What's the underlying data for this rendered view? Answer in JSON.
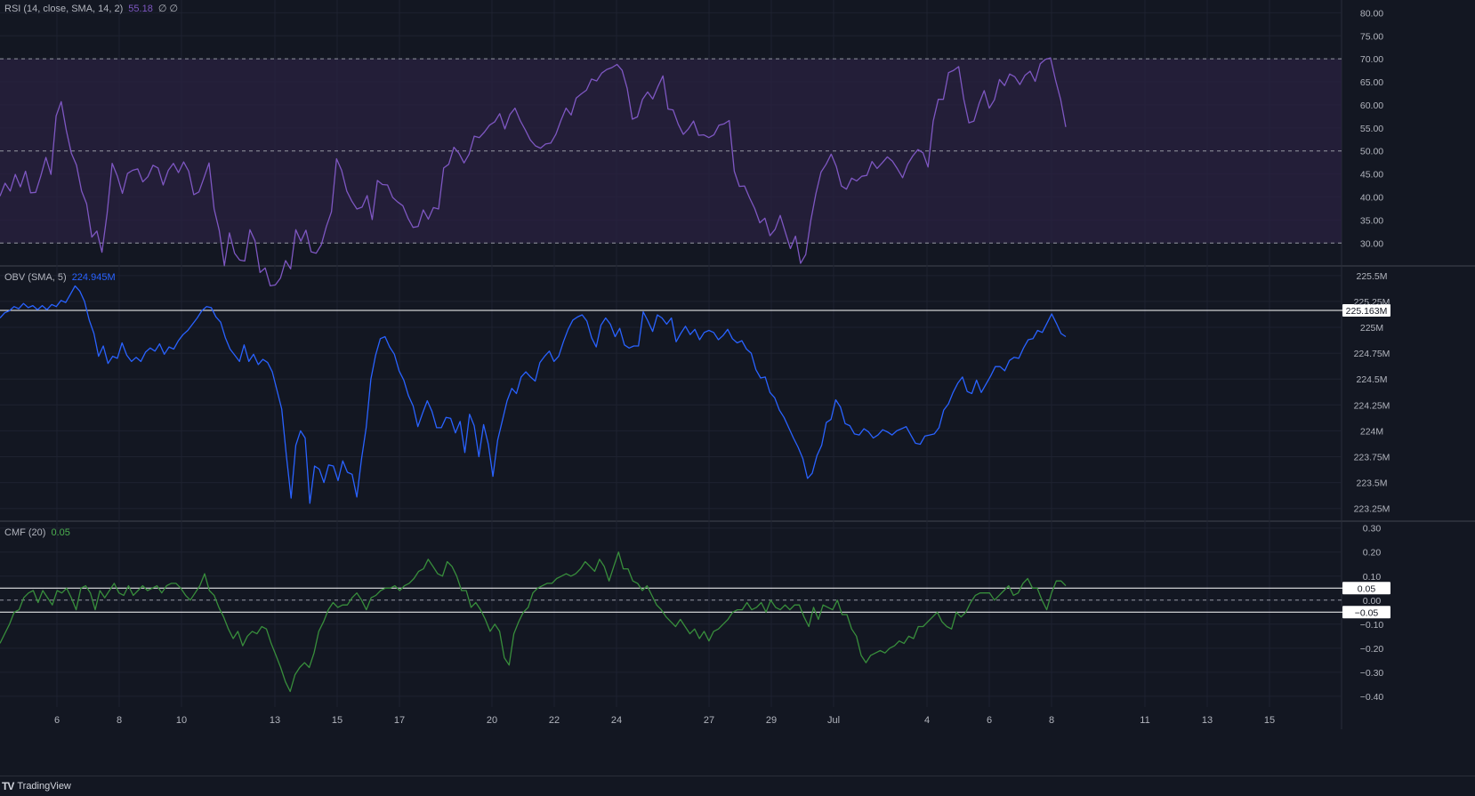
{
  "brand": {
    "name": "TradingView",
    "logo": "TV"
  },
  "colors": {
    "background": "#131722",
    "grid": "#1e2230",
    "separator": "#2a2e39",
    "rsi": "#7e57c2",
    "rsi_band": "#2a2140",
    "obv": "#2962ff",
    "cmf": "#388e3c",
    "level_line": "#ffffff",
    "text": "#b2b5be"
  },
  "x_axis": {
    "labels": [
      "6",
      "8",
      "10",
      "13",
      "15",
      "17",
      "20",
      "22",
      "24",
      "27",
      "29",
      "Jul",
      "4",
      "6",
      "8",
      "11",
      "13",
      "15"
    ]
  },
  "chart_data": [
    {
      "type": "line",
      "title": "RSI (14, close, SMA, 14, 2)",
      "legend_value": "55.18",
      "legend_extra": "∅ ∅",
      "ylim": [
        26,
        82
      ],
      "y_ticks": [
        "80.00",
        "75.00",
        "70.00",
        "65.00",
        "60.00",
        "55.00",
        "50.00",
        "45.00",
        "40.00",
        "35.00",
        "30.00"
      ],
      "levels": [
        70,
        50,
        30
      ],
      "band": [
        30,
        70
      ],
      "series": [
        {
          "values": [
            40.2,
            43,
            41.3,
            44.9,
            42.2,
            45.6,
            40.9,
            41,
            44.6,
            48.6,
            44.9,
            57.6,
            60.7,
            54.5,
            49.5,
            46.9,
            41.3,
            38.5,
            31.3,
            32.6,
            28,
            36.4,
            47.3,
            44.6,
            40.8,
            45.1,
            45.8,
            46.1,
            43.3,
            44.4,
            46.9,
            46.3,
            42.6,
            45.8,
            47.3,
            45.3,
            47.6,
            45.6,
            40.5,
            41.1,
            44.2,
            47.4,
            37.4,
            32.7,
            25.1,
            32.2,
            27.8,
            26.3,
            26.1,
            32.9,
            30.5,
            23.6,
            24.6,
            20.7,
            20.9,
            22.4,
            26.2,
            24.4,
            32.9,
            30.4,
            32.8,
            28.1,
            27.8,
            29.6,
            33.6,
            36.8,
            48.3,
            45.8,
            41.3,
            39.1,
            37.4,
            37.8,
            40.3,
            35.1,
            43.6,
            42.7,
            42.6,
            39.9,
            38.9,
            38.1,
            35.4,
            33.4,
            33.6,
            37.2,
            35.2,
            37.7,
            37.4,
            46.3,
            47.1,
            50.8,
            49.5,
            47.4,
            49.3,
            53.2,
            52.9,
            54.1,
            55.6,
            56.3,
            58.1,
            54.8,
            57.9,
            59.3,
            56.6,
            54.6,
            52.4,
            51.1,
            50.6,
            51.5,
            51.7,
            53.6,
            56.6,
            59.3,
            57.8,
            61.5,
            62.4,
            63.2,
            65.6,
            65.2,
            66.9,
            67.7,
            68.1,
            68.8,
            67.5,
            63.6,
            56.9,
            57.4,
            61.2,
            62.8,
            61.3,
            63.9,
            66.3,
            59.1,
            58.9,
            55.8,
            53.6,
            54.8,
            56.5,
            53.4,
            53.5,
            52.9,
            53.5,
            55.6,
            55.9,
            56.6,
            45.6,
            42.3,
            42.4,
            39.8,
            37.5,
            34.4,
            35.4,
            31.6,
            33,
            36,
            32.4,
            28.8,
            31.5,
            25.6,
            27.5,
            34.9,
            40.7,
            45.4,
            47.1,
            49.3,
            46.6,
            42.4,
            41.7,
            44.1,
            43.5,
            44.5,
            44.7,
            47.7,
            46.2,
            47.4,
            48.7,
            47.8,
            46.1,
            44.2,
            47.1,
            48.9,
            50.3,
            49.6,
            46.5,
            56.5,
            61.2,
            61.2,
            67,
            67.5,
            68.3,
            61.2,
            56.1,
            56.5,
            60.3,
            63.1,
            59.3,
            61.1,
            65.5,
            64.2,
            66.7,
            66.1,
            64.4,
            66.4,
            67.3,
            65.1,
            68.9,
            69.9,
            70.2,
            65.4,
            61.1,
            55.2
          ]
        }
      ]
    },
    {
      "type": "line",
      "title": "OBV (SMA, 5)",
      "legend_value": "224.945M",
      "ylim": [
        223.17,
        225.55
      ],
      "y_ticks": [
        "225.5M",
        "225.25M",
        "225M",
        "224.75M",
        "224.5M",
        "224.25M",
        "224M",
        "223.75M",
        "223.5M",
        "223.25M"
      ],
      "y_tick_values": [
        225.5,
        225.25,
        225,
        224.75,
        224.5,
        224.25,
        224,
        223.75,
        223.5,
        223.25
      ],
      "levels": [
        225.163
      ],
      "level_labels": [
        "225.163M"
      ],
      "series": [
        {
          "values": [
            225.09,
            225.14,
            225.16,
            225.2,
            225.18,
            225.23,
            225.19,
            225.21,
            225.17,
            225.21,
            225.17,
            225.22,
            225.2,
            225.26,
            225.24,
            225.32,
            225.4,
            225.35,
            225.25,
            225.07,
            224.94,
            224.72,
            224.82,
            224.65,
            224.72,
            224.7,
            224.85,
            224.73,
            224.67,
            224.71,
            224.67,
            224.76,
            224.8,
            224.77,
            224.84,
            224.74,
            224.81,
            224.79,
            224.87,
            224.93,
            224.97,
            225.03,
            225.09,
            225.16,
            225.2,
            225.19,
            225.1,
            225.05,
            224.9,
            224.79,
            224.73,
            224.67,
            224.83,
            224.67,
            224.74,
            224.64,
            224.69,
            224.66,
            224.57,
            224.39,
            224.21,
            223.76,
            223.35,
            223.86,
            224,
            223.93,
            223.3,
            223.66,
            223.63,
            223.5,
            223.67,
            223.66,
            223.52,
            223.71,
            223.6,
            223.58,
            223.36,
            223.73,
            224.03,
            224.5,
            224.73,
            224.89,
            224.91,
            224.81,
            224.74,
            224.58,
            224.49,
            224.34,
            224.24,
            224.04,
            224.17,
            224.29,
            224.19,
            224.03,
            224.03,
            224.13,
            224.12,
            223.98,
            224.09,
            223.79,
            224.16,
            224.05,
            223.75,
            224.06,
            223.87,
            223.56,
            223.91,
            224.1,
            224.29,
            224.41,
            224.36,
            224.52,
            224.57,
            224.52,
            224.48,
            224.66,
            224.72,
            224.77,
            224.67,
            224.72,
            224.86,
            224.98,
            225.07,
            225.1,
            225.12,
            225.06,
            224.9,
            224.81,
            225.02,
            225.09,
            225.03,
            224.91,
            224.99,
            224.83,
            224.8,
            224.82,
            224.82,
            225.15,
            225.06,
            224.96,
            225.12,
            225.09,
            225.03,
            225.09,
            224.86,
            224.94,
            225.01,
            224.93,
            224.98,
            224.88,
            224.95,
            224.97,
            224.95,
            224.88,
            224.92,
            224.98,
            224.89,
            224.85,
            224.87,
            224.79,
            224.75,
            224.59,
            224.51,
            224.52,
            224.37,
            224.32,
            224.2,
            224.13,
            224.03,
            223.93,
            223.84,
            223.73,
            223.54,
            223.59,
            223.76,
            223.86,
            224.08,
            224.11,
            224.3,
            224.23,
            224.07,
            224.05,
            223.97,
            223.96,
            224.02,
            223.99,
            223.93,
            223.96,
            224.01,
            223.99,
            223.96,
            224,
            224.02,
            224.04,
            223.96,
            223.88,
            223.87,
            223.95,
            223.96,
            223.97,
            224.03,
            224.2,
            224.26,
            224.37,
            224.46,
            224.52,
            224.38,
            224.36,
            224.49,
            224.37,
            224.45,
            224.53,
            224.62,
            224.62,
            224.58,
            224.68,
            224.71,
            224.7,
            224.8,
            224.88,
            224.89,
            224.97,
            224.95,
            225.04,
            225.13,
            225.04,
            224.94,
            224.91
          ]
        }
      ]
    },
    {
      "type": "line",
      "title": "CMF (20)",
      "legend_value": "0.05",
      "ylim": [
        -0.43,
        0.31
      ],
      "y_ticks": [
        "0.30",
        "0.20",
        "0.10",
        "0.00",
        "−0.10",
        "−0.20",
        "−0.30",
        "−0.40"
      ],
      "y_tick_values": [
        0.3,
        0.2,
        0.1,
        0,
        -0.1,
        -0.2,
        -0.3,
        -0.4
      ],
      "levels": [
        0.05,
        -0.05
      ],
      "level_labels": [
        "0.05",
        "−0.05"
      ],
      "dashed_levels": [
        0
      ],
      "series": [
        {
          "values": [
            -0.18,
            -0.14,
            -0.1,
            -0.05,
            -0.04,
            0.01,
            0.03,
            0.04,
            -0.01,
            0.04,
            0.01,
            -0.02,
            0.04,
            0.03,
            0.05,
            0.01,
            -0.04,
            0.05,
            0.06,
            0.03,
            -0.04,
            0.04,
            0.01,
            0.04,
            0.07,
            0.03,
            0.02,
            0.06,
            0.02,
            0.04,
            0.06,
            0.04,
            0.05,
            0.06,
            0.03,
            0.06,
            0.07,
            0.07,
            0.05,
            0.02,
            0,
            0.03,
            0.06,
            0.11,
            0.04,
            0.02,
            -0.03,
            -0.07,
            -0.12,
            -0.16,
            -0.13,
            -0.19,
            -0.15,
            -0.13,
            -0.14,
            -0.11,
            -0.12,
            -0.18,
            -0.23,
            -0.28,
            -0.34,
            -0.38,
            -0.31,
            -0.28,
            -0.26,
            -0.28,
            -0.22,
            -0.13,
            -0.09,
            -0.04,
            -0.01,
            -0.03,
            -0.02,
            -0.02,
            0.01,
            0.03,
            0,
            -0.04,
            0.01,
            0.02,
            0.04,
            0.05,
            0.05,
            0.06,
            0.04,
            0.06,
            0.07,
            0.09,
            0.12,
            0.13,
            0.17,
            0.14,
            0.11,
            0.1,
            0.16,
            0.14,
            0.1,
            0.04,
            0.04,
            -0.03,
            -0.01,
            -0.04,
            -0.08,
            -0.13,
            -0.1,
            -0.13,
            -0.24,
            -0.27,
            -0.14,
            -0.09,
            -0.05,
            -0.03,
            0.03,
            0.05,
            0.06,
            0.07,
            0.07,
            0.09,
            0.1,
            0.11,
            0.1,
            0.11,
            0.13,
            0.16,
            0.14,
            0.12,
            0.17,
            0.14,
            0.08,
            0.14,
            0.2,
            0.13,
            0.13,
            0.08,
            0.07,
            0.04,
            0.06,
            0.02,
            -0.02,
            -0.04,
            -0.07,
            -0.09,
            -0.11,
            -0.08,
            -0.11,
            -0.14,
            -0.12,
            -0.16,
            -0.13,
            -0.17,
            -0.13,
            -0.12,
            -0.1,
            -0.08,
            -0.05,
            -0.04,
            -0.04,
            -0.01,
            -0.04,
            -0.03,
            -0.01,
            -0.05,
            0,
            -0.03,
            -0.04,
            -0.02,
            -0.04,
            -0.02,
            -0.02,
            -0.07,
            -0.11,
            -0.03,
            -0.08,
            -0.02,
            -0.03,
            -0.04,
            0,
            -0.06,
            -0.06,
            -0.12,
            -0.15,
            -0.23,
            -0.26,
            -0.23,
            -0.22,
            -0.21,
            -0.22,
            -0.2,
            -0.19,
            -0.17,
            -0.18,
            -0.15,
            -0.16,
            -0.11,
            -0.11,
            -0.09,
            -0.07,
            -0.05,
            -0.09,
            -0.11,
            -0.12,
            -0.05,
            -0.07,
            -0.05,
            -0.01,
            0.02,
            0.03,
            0.03,
            0.03,
            0,
            0.02,
            0.04,
            0.06,
            0.02,
            0.03,
            0.07,
            0.09,
            0.05,
            0.05,
            0,
            -0.04,
            0.03,
            0.08,
            0.08,
            0.06
          ]
        }
      ]
    }
  ]
}
